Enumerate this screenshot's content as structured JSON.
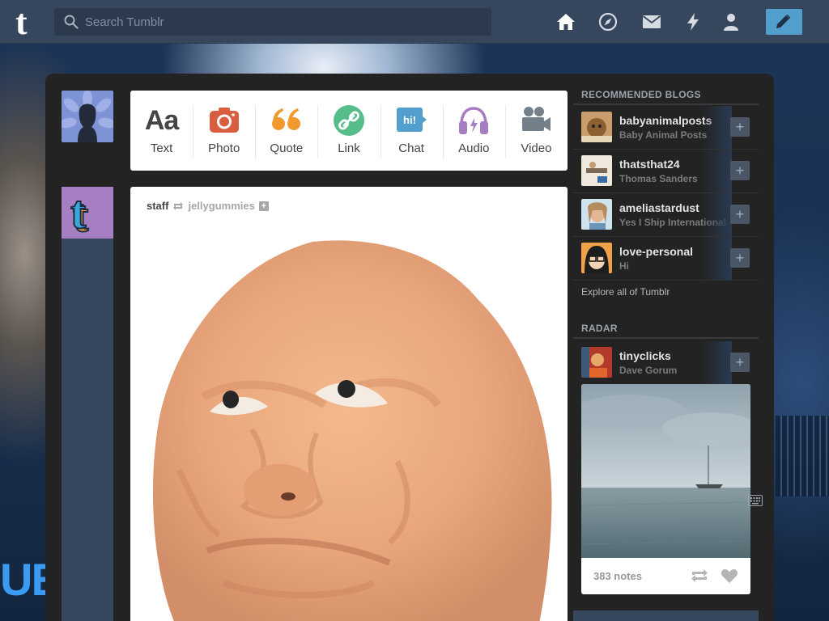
{
  "app": {
    "name": "Tumblr"
  },
  "search": {
    "placeholder": "Search Tumblr",
    "value": ""
  },
  "nav": {
    "icons": [
      "home-icon",
      "explore-icon",
      "inbox-icon",
      "activity-icon",
      "account-icon"
    ],
    "compose_icon": "pencil-icon"
  },
  "post_types": [
    {
      "label": "Aa",
      "caption": "Text",
      "icon": "text-icon",
      "color": "#444444"
    },
    {
      "label": "",
      "caption": "Photo",
      "icon": "camera-icon",
      "color": "#d95e40"
    },
    {
      "label": "",
      "caption": "Quote",
      "icon": "quote-icon",
      "color": "#f2992e"
    },
    {
      "label": "",
      "caption": "Link",
      "icon": "link-icon",
      "color": "#56bc8a"
    },
    {
      "label": "hi!",
      "caption": "Chat",
      "icon": "chat-icon",
      "color": "#529ecc"
    },
    {
      "label": "",
      "caption": "Audio",
      "icon": "headphones-icon",
      "color": "#a77dc2"
    },
    {
      "label": "",
      "caption": "Video",
      "icon": "video-camera-icon",
      "color": "#748089"
    }
  ],
  "post": {
    "author": "staff",
    "reblogged_from": "jellygummies"
  },
  "sidebar": {
    "recommended_title": "RECOMMENDED BLOGS",
    "blogs": [
      {
        "name": "babyanimalposts",
        "title": "Baby Animal Posts"
      },
      {
        "name": "thatsthat24",
        "title": "Thomas Sanders"
      },
      {
        "name": "ameliastardust",
        "title": "Yes I Ship International"
      },
      {
        "name": "love-personal",
        "title": "Hi"
      }
    ],
    "explore_link": "Explore all of Tumblr",
    "radar_title": "RADAR",
    "radar": {
      "name": "tinyclicks",
      "title": "Dave Gorum",
      "notes": "383 notes"
    }
  },
  "colors": {
    "nav_bg": "#36465d",
    "compose_bg": "#529ecc",
    "panel_bg": "#232323",
    "user_avatar": "#7e92d6",
    "post_avatar": "#a57fc1"
  }
}
